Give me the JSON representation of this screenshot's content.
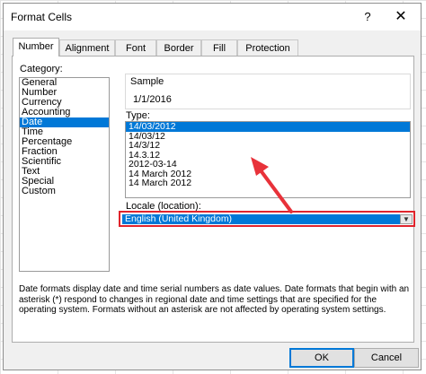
{
  "dialog": {
    "title": "Format Cells",
    "help_label": "?",
    "close_label": "✕"
  },
  "tabs": [
    "Number",
    "Alignment",
    "Font",
    "Border",
    "Fill",
    "Protection"
  ],
  "active_tab": "Number",
  "category": {
    "label": "Category:",
    "items": [
      "General",
      "Number",
      "Currency",
      "Accounting",
      "Date",
      "Time",
      "Percentage",
      "Fraction",
      "Scientific",
      "Text",
      "Special",
      "Custom"
    ],
    "selected": "Date"
  },
  "sample": {
    "label": "Sample",
    "value": "1/1/2016"
  },
  "type": {
    "label": "Type:",
    "items": [
      "14/03/2012",
      "14/03/12",
      "14/3/12",
      "14.3.12",
      "2012-03-14",
      "14 March 2012",
      "14 March 2012"
    ],
    "selected": "14/03/2012"
  },
  "locale": {
    "label": "Locale (location):",
    "value": "English (United Kingdom)",
    "dropdown_glyph": "▼"
  },
  "description": "Date formats display date and time serial numbers as date values.  Date formats that begin with an asterisk (*) respond to changes in regional date and time settings that are specified for the operating system. Formats without an asterisk are not affected by operating system settings.",
  "buttons": {
    "ok": "OK",
    "cancel": "Cancel"
  },
  "colors": {
    "selection": "#0078d7",
    "highlight_box": "#e0242c",
    "arrow": "#e8323a"
  }
}
